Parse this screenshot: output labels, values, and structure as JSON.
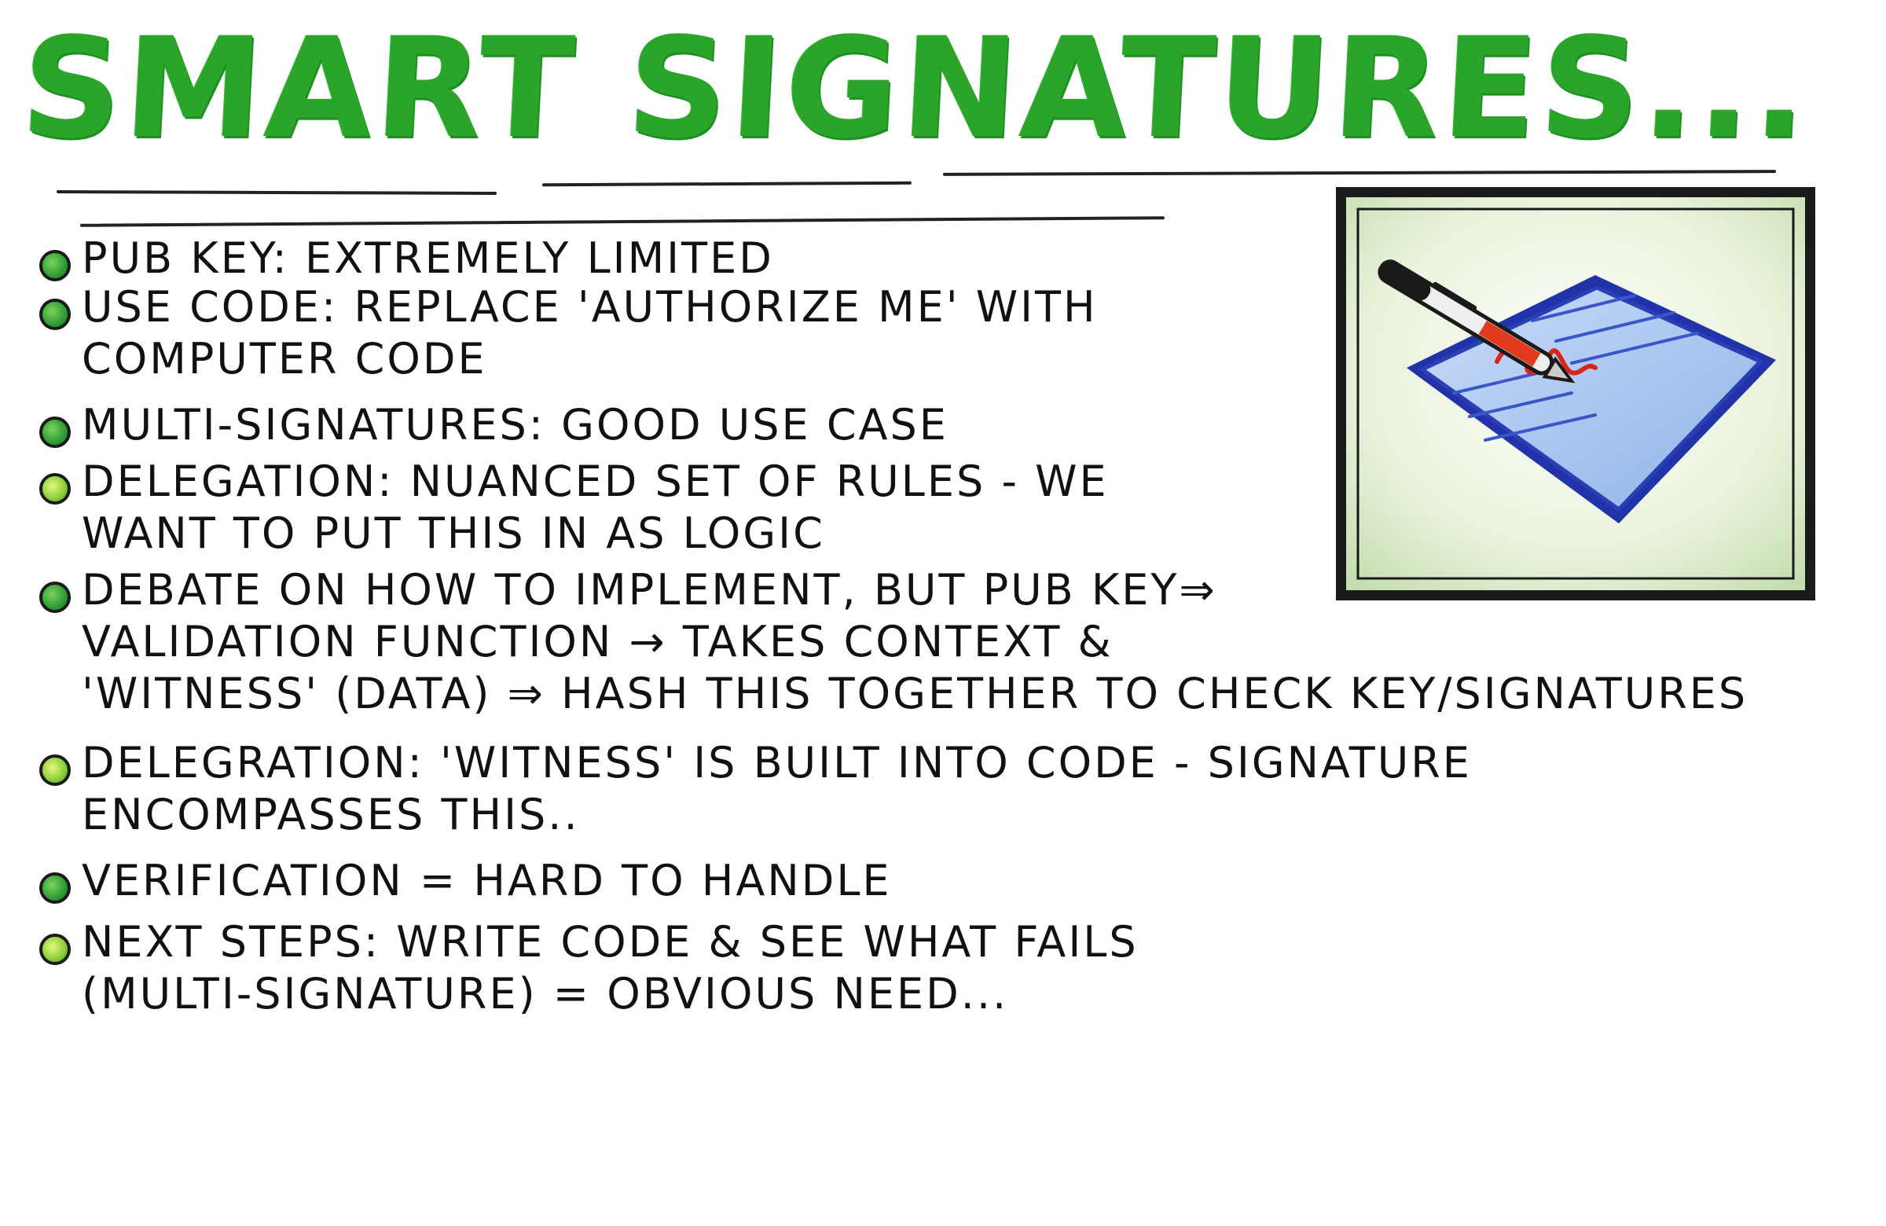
{
  "title": "SMART SIGNATURES...",
  "bullets": [
    {
      "lines": [
        "PUB KEY: EXTREMELY LIMITED"
      ],
      "dot": "dark"
    },
    {
      "lines": [
        "USE CODE: REPLACE 'AUTHORIZE ME' WITH",
        "COMPUTER CODE"
      ],
      "dot": "dark"
    },
    {
      "lines": [
        "MULTI-SIGNATURES: GOOD USE CASE"
      ],
      "dot": "dark"
    },
    {
      "lines": [
        "DELEGATION: NUANCED SET OF RULES - WE",
        "WANT TO PUT THIS IN AS LOGIC"
      ],
      "dot": "light"
    },
    {
      "lines": [
        "DEBATE ON HOW TO IMPLEMENT, BUT PUB KEY⇒",
        "VALIDATION FUNCTION → TAKES CONTEXT &",
        "'WITNESS' (DATA) ⇒ HASH THIS TOGETHER TO CHECK KEY/SIGNATURES"
      ],
      "dot": "dark"
    },
    {
      "lines": [
        "DELEGRATION: 'WITNESS' IS BUILT INTO CODE - SIGNATURE",
        "ENCOMPASSES THIS.."
      ],
      "dot": "light"
    },
    {
      "lines": [
        "VERIFICATION = HARD TO HANDLE"
      ],
      "dot": "dark"
    },
    {
      "lines": [
        "NEXT STEPS: WRITE CODE & SEE WHAT FAILS",
        "(MULTI-SIGNATURE) = OBVIOUS NEED..."
      ],
      "dot": "light"
    }
  ],
  "illustration": {
    "icon": "document-pen-signature-icon",
    "colors": {
      "frame": "#1a1a1a",
      "background": "#d6e8c2",
      "paper": "#a9c8ef",
      "paper_edge": "#2233aa",
      "pen_body": "#e8e8e8",
      "pen_accent": "#e23a1d",
      "ink": "#d8261c"
    }
  },
  "colors": {
    "title": "#2aa52a",
    "text": "#111111",
    "bullet_dark": "#2f9b36",
    "bullet_light": "#a8df3f"
  }
}
